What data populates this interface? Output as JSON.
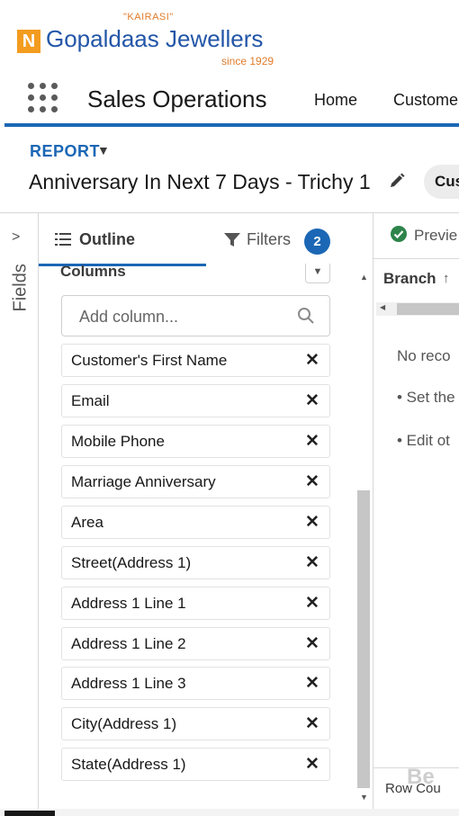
{
  "brand": {
    "tagline": "\"KAIRASI\"",
    "logo_letter": "N",
    "name": "Gopaldaas Jewellers",
    "since": "since 1929"
  },
  "app": {
    "launcher_icon": "app-launcher-icon",
    "name": "Sales Operations",
    "nav": [
      {
        "label": "Home"
      },
      {
        "label": "Custome"
      }
    ],
    "accent_color": "#1b67b5"
  },
  "report": {
    "type_label": "REPORT",
    "title": "Anniversary In Next 7 Days - Trichy 1",
    "action_pill": "Cus"
  },
  "fields_rail": {
    "label": "Fields"
  },
  "tabs": {
    "outline": "Outline",
    "filters": "Filters",
    "filters_count": "2"
  },
  "outline": {
    "heading": "Columns",
    "add_column_placeholder": "Add column...",
    "columns": [
      {
        "label": "Customer's First Name"
      },
      {
        "label": "Email"
      },
      {
        "label": "Mobile Phone"
      },
      {
        "label": "Marriage Anniversary"
      },
      {
        "label": "Area"
      },
      {
        "label": "Street(Address 1)"
      },
      {
        "label": "Address 1 Line 1"
      },
      {
        "label": "Address 1 Line 2"
      },
      {
        "label": "Address 1 Line 3"
      },
      {
        "label": "City(Address 1)"
      },
      {
        "label": "State(Address 1)"
      }
    ],
    "remove_glyph": "✕"
  },
  "preview": {
    "label": "Previe",
    "status_color": "#2e844a",
    "column_header": "Branch",
    "sort_glyph": "↑",
    "empty_message": "No reco",
    "hints": [
      "• Set the",
      "• Edit ot"
    ],
    "footer": "Row Cou",
    "watermark": "Be"
  }
}
